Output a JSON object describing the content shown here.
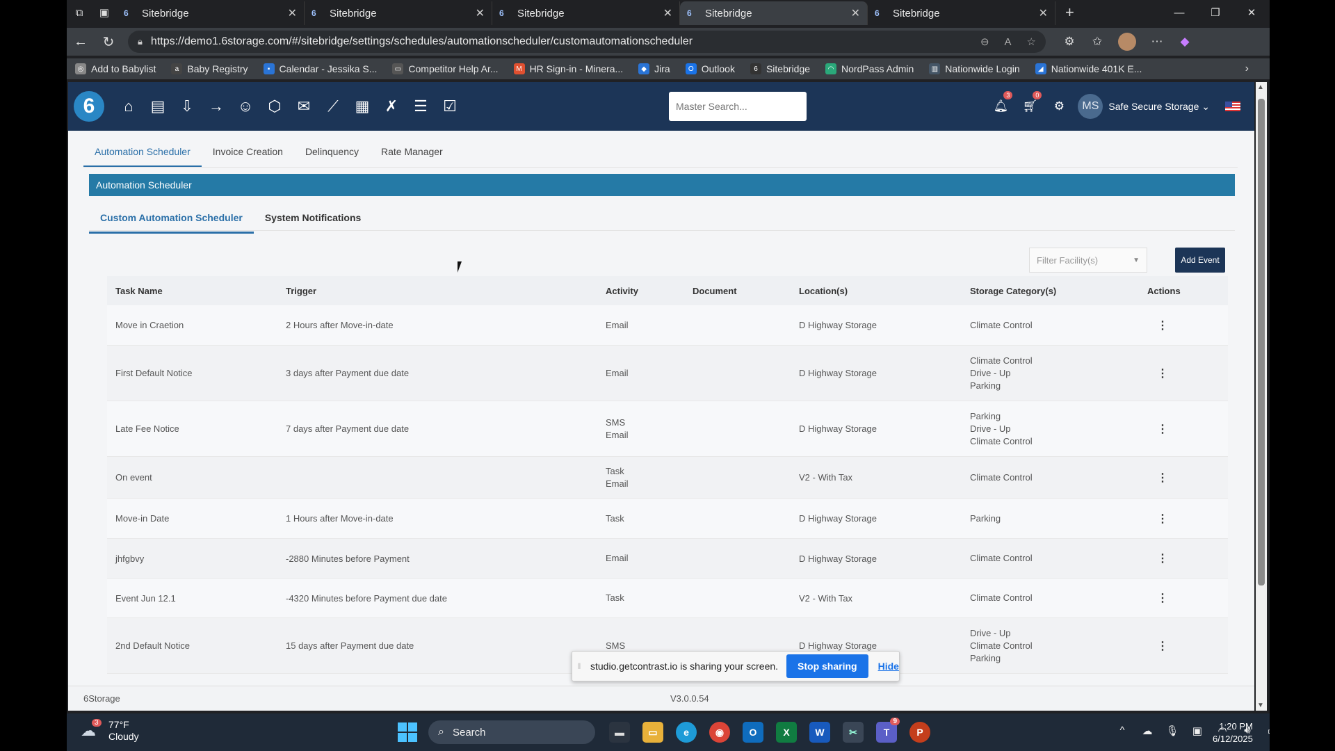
{
  "browser": {
    "tabs": [
      {
        "title": "Sitebridge",
        "active": false
      },
      {
        "title": "Sitebridge",
        "active": false
      },
      {
        "title": "Sitebridge",
        "active": false
      },
      {
        "title": "Sitebridge",
        "active": true
      },
      {
        "title": "Sitebridge",
        "active": false
      }
    ],
    "url": "https://demo1.6storage.com/#/sitebridge/settings/schedules/automationscheduler/customautomationscheduler",
    "bookmarks": [
      {
        "label": "Add to Babylist",
        "color": "#888888",
        "glyph": "◎"
      },
      {
        "label": "Baby Registry",
        "color": "#444444",
        "glyph": "a"
      },
      {
        "label": "Calendar - Jessika S...",
        "color": "#2a74d6",
        "glyph": "▪"
      },
      {
        "label": "Competitor Help Ar...",
        "color": "#555555",
        "glyph": "▭"
      },
      {
        "label": "HR Sign-in - Minera...",
        "color": "#e05030",
        "glyph": "M"
      },
      {
        "label": "Jira",
        "color": "#2a74d6",
        "glyph": "◆"
      },
      {
        "label": "Outlook",
        "color": "#1a73e8",
        "glyph": "O"
      },
      {
        "label": "Sitebridge",
        "color": "#333333",
        "glyph": "6"
      },
      {
        "label": "NordPass Admin",
        "color": "#2aa87a",
        "glyph": "◠"
      },
      {
        "label": "Nationwide Login",
        "color": "#445566",
        "glyph": "▥"
      },
      {
        "label": "Nationwide 401K E...",
        "color": "#2a74d6",
        "glyph": "◢"
      }
    ]
  },
  "app": {
    "logo": "6",
    "search_placeholder": "Master Search...",
    "notif_count": "3",
    "cart_count": "0",
    "user_initials": "MS",
    "user_name": "Safe Secure Storage",
    "main_tabs": [
      "Automation Scheduler",
      "Invoice Creation",
      "Delinquency",
      "Rate Manager"
    ],
    "banner_title": "Automation Scheduler",
    "sub_tabs": [
      "Custom Automation Scheduler",
      "System Notifications"
    ],
    "filter_placeholder": "Filter Facility(s)",
    "add_event_label": "Add Event",
    "table": {
      "headers": [
        "Task Name",
        "Trigger",
        "Activity",
        "Document",
        "Location(s)",
        "Storage Category(s)",
        "Actions"
      ],
      "rows": [
        {
          "task": "Move in Craetion",
          "trigger": "2 Hours after Move-in-date",
          "activity": [
            "Email"
          ],
          "document": "",
          "location": "D Highway Storage",
          "category": [
            "Climate Control"
          ],
          "height": 58
        },
        {
          "task": "First Default Notice",
          "trigger": "3 days after Payment due date",
          "activity": [
            "Email"
          ],
          "document": "",
          "location": "D Highway Storage",
          "category": [
            "Climate Control",
            "Drive - Up",
            "Parking"
          ],
          "height": 80
        },
        {
          "task": "Late Fee Notice",
          "trigger": "7 days after Payment due date",
          "activity": [
            "SMS",
            "Email"
          ],
          "document": "",
          "location": "D Highway Storage",
          "category": [
            "Parking",
            "Drive - Up",
            "Climate Control"
          ],
          "height": 80
        },
        {
          "task": "On event",
          "trigger": "",
          "activity": [
            "Task",
            "Email"
          ],
          "document": "",
          "location": "V2 - With Tax",
          "category": [
            "Climate Control"
          ],
          "height": 60
        },
        {
          "task": "Move-in Date",
          "trigger": "1 Hours after Move-in-date",
          "activity": [
            "Task"
          ],
          "document": "",
          "location": "D Highway Storage",
          "category": [
            "Parking"
          ],
          "height": 58
        },
        {
          "task": "jhfgbvy",
          "trigger": "-2880 Minutes before Payment",
          "activity": [
            "Email"
          ],
          "document": "",
          "location": "D Highway Storage",
          "category": [
            "Climate Control"
          ],
          "height": 57
        },
        {
          "task": "Event Jun 12.1",
          "trigger": "-4320 Minutes before Payment due date",
          "activity": [
            "Task"
          ],
          "document": "",
          "location": "V2 - With Tax",
          "category": [
            "Climate Control"
          ],
          "height": 57
        },
        {
          "task": "2nd Default Notice",
          "trigger": "15 days after Payment due date",
          "activity": [
            "SMS"
          ],
          "document": "",
          "location": "D Highway Storage",
          "category": [
            "Drive - Up",
            "Climate Control",
            "Parking"
          ],
          "height": 80
        }
      ]
    },
    "footer_brand": "6Storage",
    "version": "V3.0.0.54"
  },
  "share_bar": {
    "message": "studio.getcontrast.io is sharing your screen.",
    "stop_label": "Stop sharing",
    "hide_label": "Hide"
  },
  "taskbar": {
    "weather_badge": "3",
    "temperature": "77°F",
    "condition": "Cloudy",
    "search_label": "Search",
    "teams_badge": "9",
    "time": "1:20 PM",
    "date": "6/12/2025"
  }
}
